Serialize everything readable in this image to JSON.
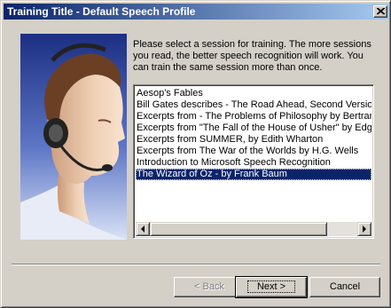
{
  "window": {
    "title": "Training Title - Default Speech Profile"
  },
  "instructions": "Please select a session for training.  The more sessions you read, the better speech recognition will work. You can train the same session more than once.",
  "sessions": [
    "Aesop's Fables",
    "Bill Gates describes - The Road Ahead, Second Version",
    "Excerpts from - The Problems of Philosophy by Bertrand Russell",
    "Excerpts from \"The Fall of the House of Usher\" by Edgar Allan Poe",
    "Excerpts from SUMMER, by Edith Wharton",
    "Excerpts from The War of the Worlds by H.G. Wells",
    "Introduction to Microsoft Speech Recognition",
    "The Wizard of Oz - by Frank Baum"
  ],
  "selected_session": "The Wizard of Oz - by Frank Baum",
  "buttons": {
    "back": "< Back",
    "next": "Next >",
    "cancel": "Cancel"
  },
  "colors": {
    "title_gradient_start": "#0a246a",
    "title_gradient_end": "#a6caf0",
    "selection": "#0a246a",
    "face": "#d4d0c8"
  },
  "icons": {
    "close": "close-icon",
    "art": "headset-user-icon",
    "scroll_left": "arrow-left-icon",
    "scroll_right": "arrow-right-icon"
  }
}
